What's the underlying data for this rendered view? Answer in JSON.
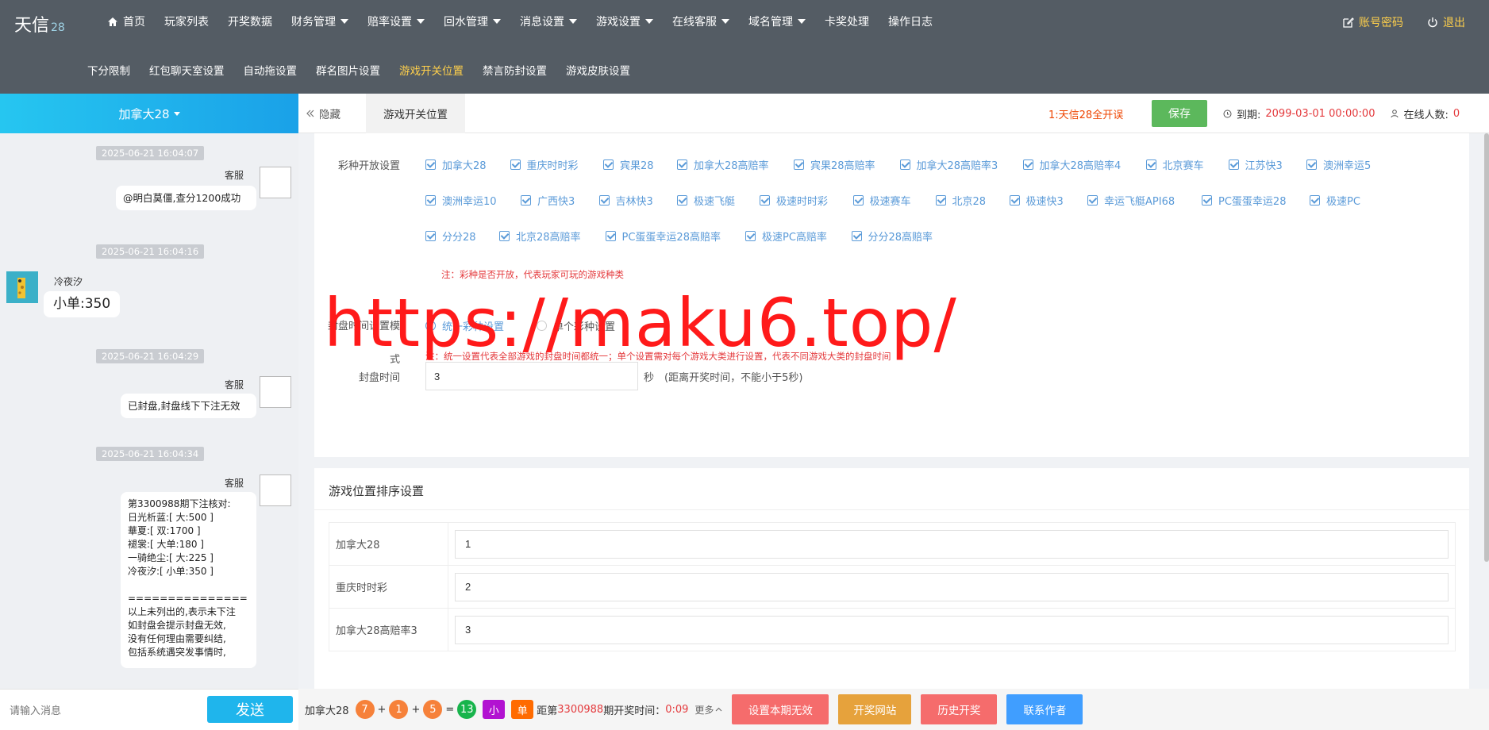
{
  "app": {
    "logo": "天信",
    "logo_suffix": "28"
  },
  "nav_primary": [
    {
      "label": "首页",
      "has_menu": false
    },
    {
      "label": "玩家列表",
      "has_menu": false
    },
    {
      "label": "开奖数据",
      "has_menu": false
    },
    {
      "label": "财务管理",
      "has_menu": true
    },
    {
      "label": "赔率设置",
      "has_menu": true
    },
    {
      "label": "回水管理",
      "has_menu": true
    },
    {
      "label": "消息设置",
      "has_menu": true
    },
    {
      "label": "游戏设置",
      "has_menu": true
    },
    {
      "label": "在线客服",
      "has_menu": true
    },
    {
      "label": "域名管理",
      "has_menu": true
    },
    {
      "label": "卡奖处理",
      "has_menu": false
    },
    {
      "label": "操作日志",
      "has_menu": false
    }
  ],
  "nav_secondary": [
    "下分限制",
    "红包聊天室设置",
    "自动拖设置",
    "群名图片设置",
    "游戏开关位置",
    "禁言防封设置",
    "游戏皮肤设置"
  ],
  "nav_secondary_active": "游戏开关位置",
  "topright": {
    "account": "账号密码",
    "logout": "退出"
  },
  "left": {
    "header": "加拿大28",
    "chat": [
      {
        "time": "2025-06-21 16:04:07",
        "name": "客服",
        "text": "@明白莫僵,查分1200成功"
      },
      {
        "time": "2025-06-21 16:04:16",
        "name": "冷夜汐",
        "text": "小单:350"
      },
      {
        "time": "2025-06-21 16:04:29",
        "name": "客服",
        "text": "已封盘,封盘线下下注无效"
      },
      {
        "time": "2025-06-21 16:04:34",
        "name": "客服",
        "text": "第3300988期下注核对:\n日光析蓝:[ 大:500 ]\n華夏:[ 双:1700 ]\n褪裳:[ 大单:180 ]\n一骑绝尘:[ 大:225 ]\n冷夜汐:[ 小单:350 ]\n\n===============\n以上未列出的,表示未下注\n如封盘会提示封盘无效,\n没有任何理由需要纠结,\n包括系统遇突发事情时,"
      }
    ],
    "input_placeholder": "请输入消息",
    "send": "发送"
  },
  "tabbar": {
    "hide": "隐藏",
    "current_tab": "游戏开关位置",
    "marquee": "1:天信28全开误",
    "save": "保存",
    "expiry_label": "到期:",
    "expiry_value": "2099-03-01 00:00:00",
    "online_label": "在线人数:",
    "online_value": "0"
  },
  "lottery": {
    "label": "彩种开放设置",
    "items": [
      "加拿大28",
      "重庆时时彩",
      "宾果28",
      "加拿大28高赔率",
      "宾果28高赔率",
      "加拿大28高赔率3",
      "加拿大28高赔率4",
      "北京赛车",
      "江苏快3",
      "澳洲幸运5",
      "澳洲幸运10",
      "广西快3",
      "吉林快3",
      "极速飞艇",
      "极速时时彩",
      "极速赛车",
      "北京28",
      "极速快3",
      "幸运飞艇API68",
      "PC蛋蛋幸运28",
      "极速PC",
      "分分28",
      "北京28高赔率",
      "PC蛋蛋幸运28高赔率",
      "极速PC高赔率",
      "分分28高赔率"
    ],
    "note": "注：彩种是否开放，代表玩家可玩的游戏种类"
  },
  "closing": {
    "label_line1": "封盘时间设置模",
    "label_line2": "式",
    "option_unified": "统一彩种设置",
    "option_single": "单个彩种设置",
    "note": "注：统一设置代表全部游戏的封盘时间都统一；单个设置需对每个游戏大类进行设置，代表不同游戏大类的封盘时间",
    "time_label": "封盘时间",
    "time_value": "3",
    "time_suffix": "秒　(距离开奖时间，不能小于5秒)"
  },
  "watermark": "https://maku6.top/",
  "sort": {
    "title": "游戏位置排序设置",
    "rows": [
      {
        "label": "加拿大28",
        "value": "1"
      },
      {
        "label": "重庆时时彩",
        "value": "2"
      },
      {
        "label": "加拿大28高赔率3",
        "value": "3"
      }
    ]
  },
  "bottom": {
    "game": "加拿大28",
    "balls": [
      "7",
      "1",
      "5"
    ],
    "plus": "+",
    "equals": "=",
    "sum": "13",
    "size": "小",
    "parity": "单",
    "period_prefix": "距第",
    "period": "3300988",
    "period_suffix": "期开奖时间：",
    "countdown": "0:09",
    "more": "更多",
    "buttons": [
      {
        "label": "设置本期无效",
        "color": "#f56c6c"
      },
      {
        "label": "开奖网站",
        "color": "#e6a23c"
      },
      {
        "label": "历史开奖",
        "color": "#f56c6c"
      },
      {
        "label": "联系作者",
        "color": "#409eff"
      }
    ]
  },
  "colors": {
    "topbar": "#545c64",
    "active_nav": "#ffd04b",
    "accent": "#1fb5ec",
    "save": "#5cb85c",
    "checkbox": "#5a9ad8",
    "note": "#e4393c"
  }
}
